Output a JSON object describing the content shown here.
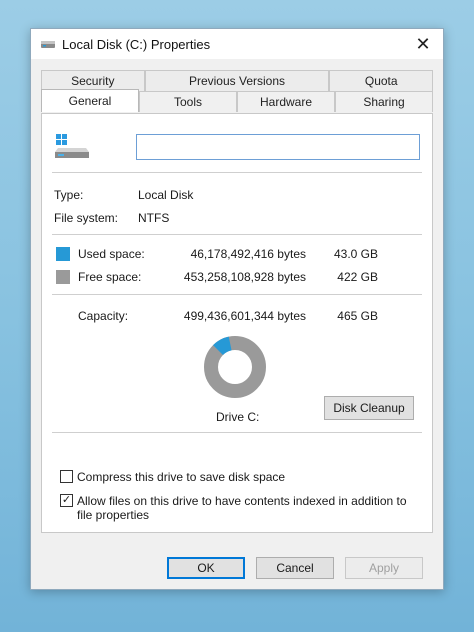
{
  "window": {
    "title": "Local Disk (C:) Properties",
    "close_glyph": "✕"
  },
  "tabs": {
    "back_row": [
      "Security",
      "Previous Versions",
      "Quota"
    ],
    "front_row": [
      "General",
      "Tools",
      "Hardware",
      "Sharing"
    ],
    "active": "General"
  },
  "general": {
    "name_value": "",
    "type_label": "Type:",
    "type_value": "Local Disk",
    "fs_label": "File system:",
    "fs_value": "NTFS",
    "used_label": "Used space:",
    "used_bytes": "46,178,492,416 bytes",
    "used_gb": "43.0 GB",
    "free_label": "Free space:",
    "free_bytes": "453,258,108,928 bytes",
    "free_gb": "422 GB",
    "capacity_label": "Capacity:",
    "capacity_bytes": "499,436,601,344 bytes",
    "capacity_gb": "465 GB",
    "used_fraction": 0.0925,
    "drive_label": "Drive C:",
    "cleanup_label": "Disk Cleanup",
    "compress_label": "Compress this drive to save disk space",
    "compress_checked": false,
    "index_label": "Allow files on this drive to have contents indexed in addition to file properties",
    "index_checked": true
  },
  "buttons": {
    "ok": "OK",
    "cancel": "Cancel",
    "apply": "Apply"
  },
  "colors": {
    "used": "#2699d6",
    "free": "#9a9a9a",
    "accent": "#0078d7"
  },
  "icons": {
    "title": "drive-icon",
    "close": "close-icon",
    "drive": "windows-drive-icon",
    "check": "checkmark-icon"
  }
}
